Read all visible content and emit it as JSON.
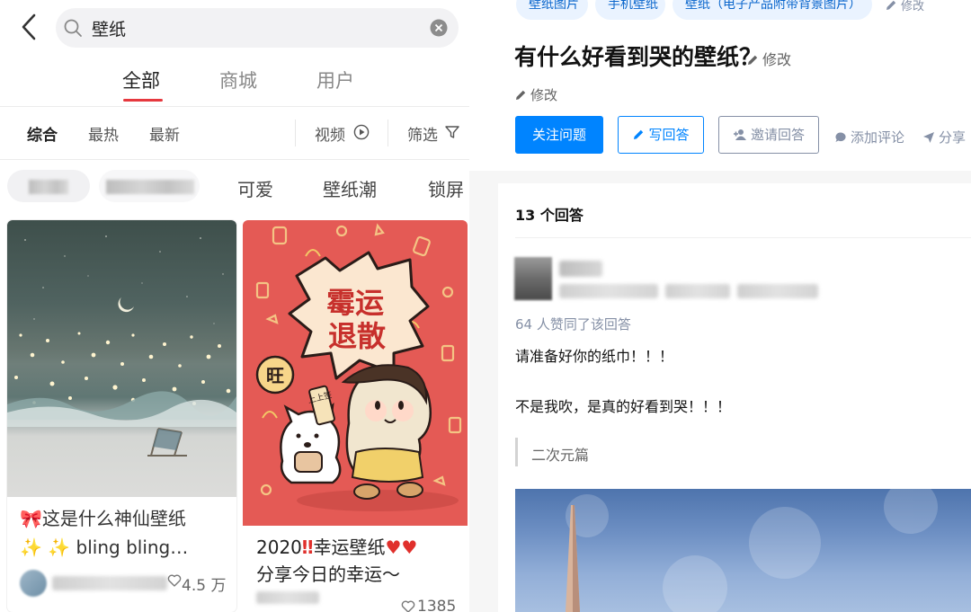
{
  "left": {
    "search": {
      "query": "壁纸"
    },
    "tabs": [
      "全部",
      "商城",
      "用户"
    ],
    "filters": {
      "sort": [
        "综合",
        "最热",
        "最新"
      ],
      "video": "视频",
      "filter": "筛选"
    },
    "chips": [
      "可爱",
      "壁纸潮",
      "锁屏"
    ],
    "cards": [
      {
        "title_line1": "这是什么神仙壁纸",
        "title_line2": "bling bling…",
        "likes": "4.5 万"
      },
      {
        "title_line1": "2020",
        "title_line1_rest": "幸运壁纸",
        "title_line2": "分享今日的幸运～",
        "likes": "1385",
        "poster": {
          "line1": "霉运",
          "line2": "退散",
          "badge": "旺",
          "sign": "上上签"
        }
      }
    ]
  },
  "right": {
    "topics": [
      "壁纸图片",
      "手机壁纸",
      "壁纸（电子产品附带背景图片）"
    ],
    "top_edit": "修改",
    "question_title": "有什么好看到哭的壁纸？",
    "edit_label": "修改",
    "buttons": {
      "follow": "关注问题",
      "write": "写回答",
      "invite": "邀请回答",
      "comment": "添加评论",
      "share": "分享"
    },
    "answer_count": "13 个回答",
    "answer": {
      "votes": "64 人赞同了该回答",
      "line1": "请准备好你的纸巾！！！",
      "line2": "不是我吹，是真的好看到哭！！！",
      "quote": "二次元篇"
    }
  }
}
